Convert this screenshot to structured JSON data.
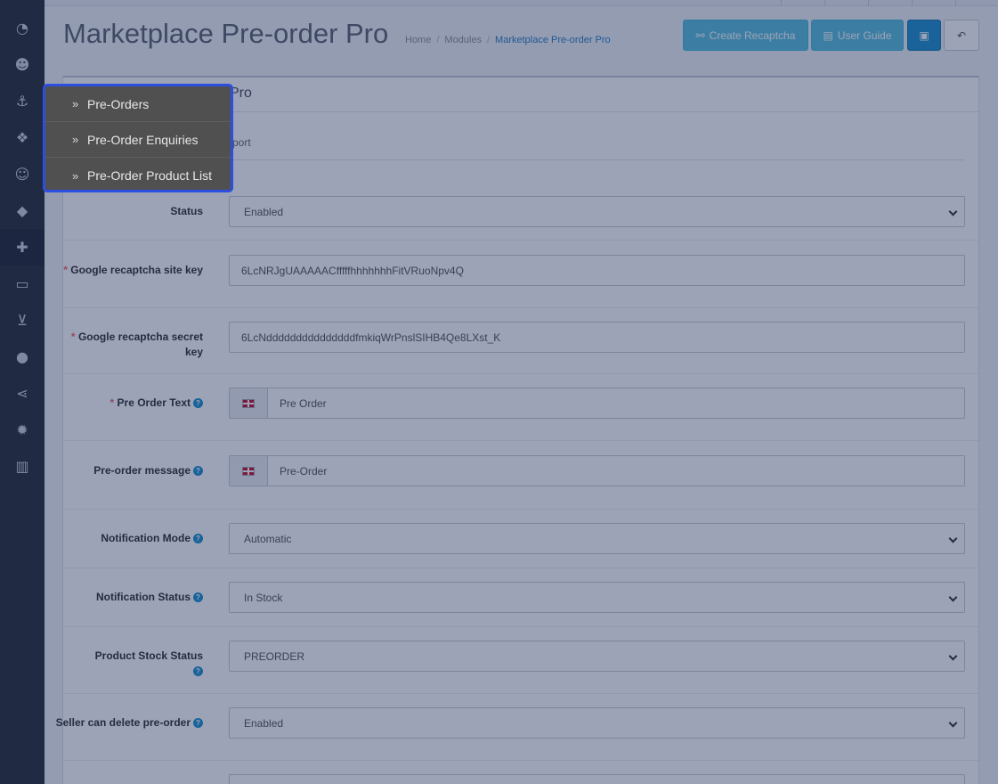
{
  "header": {
    "title": "Marketplace Pre-order Pro",
    "breadcrumb": [
      "Home",
      "Modules",
      "Marketplace Pre-order Pro"
    ],
    "buttons": {
      "create_recaptcha": "Create Recaptcha",
      "user_guide": "User Guide"
    }
  },
  "panel": {
    "heading_fragment": "Pro",
    "tab_fragment": "port"
  },
  "form": {
    "status": {
      "label": "Status",
      "value": "Enabled"
    },
    "site_key": {
      "label": "Google recaptcha site key",
      "required": "*",
      "value": "6LcNRJgUAAAAACfffffhhhhhhhFitVRuoNpv4Q"
    },
    "secret_key": {
      "label": "Google recaptcha secret key",
      "required": "*",
      "value": "6LcNdddddddddddddddfmkiqWrPnslSIHB4Qe8LXst_K"
    },
    "pre_order_text": {
      "label": "Pre Order Text",
      "required": "*",
      "value": "Pre Order"
    },
    "pre_order_message": {
      "label": "Pre-order message",
      "value": "Pre-Order"
    },
    "notification_mode": {
      "label": "Notification Mode",
      "value": "Automatic"
    },
    "notification_status": {
      "label": "Notification Status",
      "value": "In Stock"
    },
    "product_stock_status": {
      "label": "Product Stock Status",
      "value": "PREORDER"
    },
    "seller_delete": {
      "label": "Seller can delete pre-order",
      "value": "Enabled"
    }
  },
  "flyout": {
    "items": [
      "Pre-Orders",
      "Pre-Order Enquiries",
      "Pre-Order Product List"
    ]
  },
  "colors": {
    "highlight_border": "#2d4fe0",
    "sidebar": "#2b2f3a",
    "primary": "#1e91cf",
    "info": "#5bc0de"
  }
}
